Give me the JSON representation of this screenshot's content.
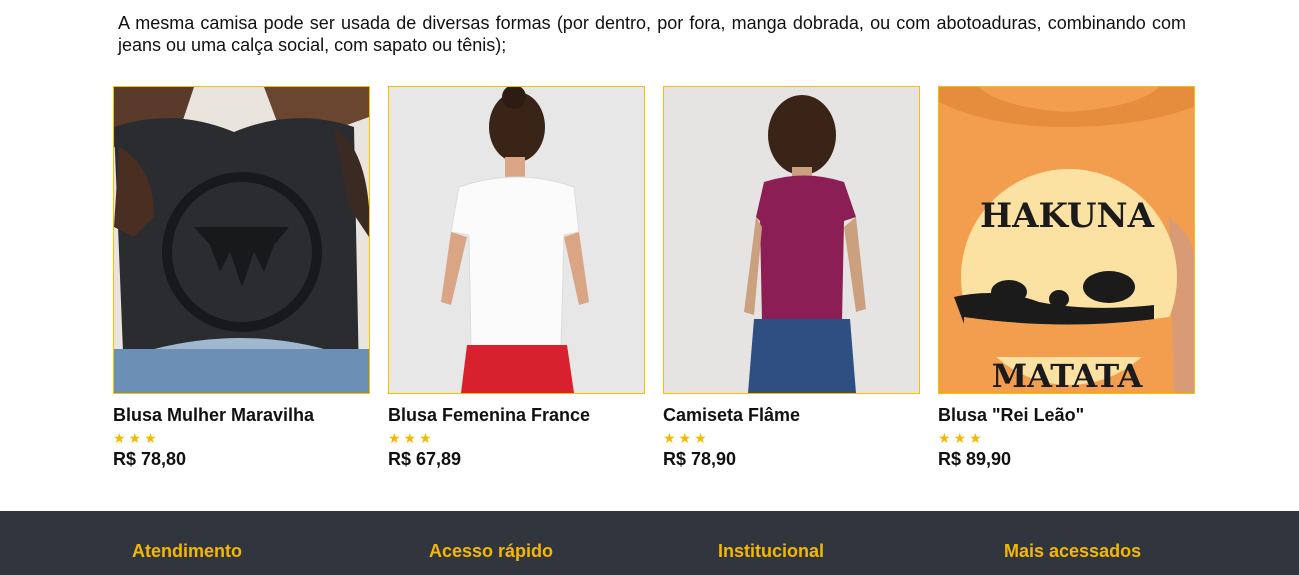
{
  "intro": {
    "text": "A mesma camisa pode ser usada de diversas formas (por dentro, por fora, manga dobrada, ou com abotoaduras, combinando com jeans ou uma calça social, com sapato ou tênis);"
  },
  "products": [
    {
      "name": "Blusa Mulher Maravilha",
      "stars": "★★★",
      "rating": 3,
      "price": "R$ 78,80",
      "image": "woman-black-tshirt-wonder-woman-logo"
    },
    {
      "name": "Blusa Femenina France",
      "stars": "★★★",
      "rating": 3,
      "price": "R$ 67,89",
      "image": "woman-white-tshirt-back-view"
    },
    {
      "name": "Camiseta Flâme",
      "stars": "★★★",
      "rating": 3,
      "price": "R$ 78,90",
      "image": "woman-purple-tshirt-back-view"
    },
    {
      "name": "Blusa \"Rei Leão\"",
      "stars": "★★★",
      "rating": 3,
      "price": "R$ 89,90",
      "image": "orange-tshirt-hakuna-matata-print"
    }
  ],
  "print_text": {
    "line1": "HAKUNA",
    "line2": "MATATA"
  },
  "footer": {
    "columns": [
      {
        "title": "Atendimento"
      },
      {
        "title": "Acesso rápido"
      },
      {
        "title": "Institucional"
      },
      {
        "title": "Mais acessados"
      }
    ]
  },
  "colors": {
    "accent": "#f5b800",
    "border": "#f5c000",
    "footer_bg": "#31353d"
  }
}
